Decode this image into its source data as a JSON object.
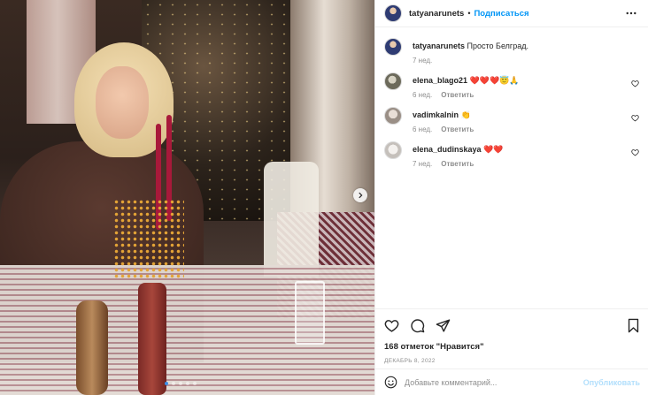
{
  "post": {
    "author": "tatyanarunets",
    "follow_label": "Подписаться",
    "separator": "•",
    "caption": "Просто Белград.",
    "caption_time": "7 нед.",
    "icons": {
      "more": "more-horizontal-icon",
      "next": "chevron-right-icon",
      "like": "heart-icon",
      "comment": "comment-bubble-icon",
      "share": "paper-plane-icon",
      "save": "bookmark-icon",
      "emoji": "smiley-icon"
    },
    "carousel": {
      "count": 5,
      "active_index": 0
    },
    "accent_color": "#0095f6"
  },
  "comments": [
    {
      "user": "elena_blago21",
      "text": "❤️❤️❤️😇🙏",
      "time": "6 нед.",
      "reply": "Ответить"
    },
    {
      "user": "vadimkalnin",
      "text": "👏",
      "time": "6 нед.",
      "reply": "Ответить"
    },
    {
      "user": "elena_dudinskaya",
      "text": "❤️❤️",
      "time": "7 нед.",
      "reply": "Ответить"
    }
  ],
  "stats": {
    "likes": "168 отметок \"Нравится\"",
    "date": "декабрь 8, 2022"
  },
  "add_comment": {
    "placeholder": "Добавьте комментарий...",
    "publish_label": "Опубликовать"
  }
}
